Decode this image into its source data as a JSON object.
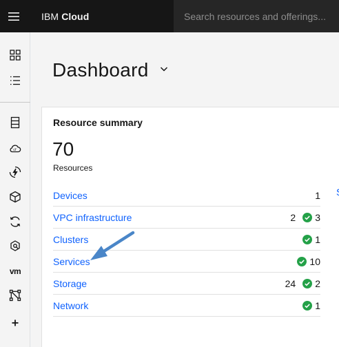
{
  "header": {
    "brand_ibm": "IBM",
    "brand_cloud": "Cloud",
    "search_placeholder": "Search resources and offerings..."
  },
  "rail": {
    "items": [
      {
        "icon": "dashboard-icon"
      },
      {
        "icon": "resource-list-icon"
      },
      {
        "icon": "classic-infrastructure-icon"
      },
      {
        "icon": "cloud-foundry-icon"
      },
      {
        "icon": "functions-icon"
      },
      {
        "icon": "kubernetes-icon"
      },
      {
        "icon": "openshift-icon"
      },
      {
        "icon": "satellite-icon"
      },
      {
        "icon": "vmware-icon",
        "text": "vm"
      },
      {
        "icon": "vpc-icon"
      },
      {
        "icon": "add-icon"
      }
    ]
  },
  "page": {
    "title": "Dashboard"
  },
  "resource_summary": {
    "title": "Resource summary",
    "count": "70",
    "count_label": "Resources",
    "rows": [
      {
        "label": "Devices",
        "plain": "1",
        "ok": ""
      },
      {
        "label": "VPC infrastructure",
        "plain": "2",
        "ok": "3"
      },
      {
        "label": "Clusters",
        "plain": "",
        "ok": "1"
      },
      {
        "label": "Services",
        "plain": "",
        "ok": "10"
      },
      {
        "label": "Storage",
        "plain": "24",
        "ok": "2"
      },
      {
        "label": "Network",
        "plain": "",
        "ok": "1"
      }
    ],
    "peek_text": "S"
  },
  "colors": {
    "header_bg": "#161616",
    "search_bg": "#262626",
    "link": "#0f62fe",
    "ok_green": "#24a148",
    "annotation_arrow": "#4a86c8"
  }
}
